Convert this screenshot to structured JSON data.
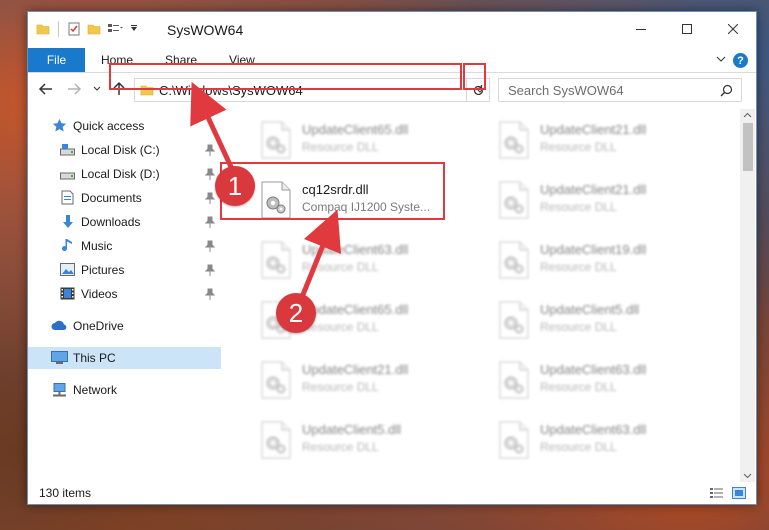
{
  "window": {
    "title": "SysWOW64"
  },
  "ribbon": {
    "tabs": [
      {
        "label": "File"
      },
      {
        "label": "Home"
      },
      {
        "label": "Share"
      },
      {
        "label": "View"
      }
    ]
  },
  "navigation": {
    "address": "C:\\Windows\\SysWOW64",
    "search_placeholder": "Search SysWOW64"
  },
  "sidebar": {
    "items": [
      {
        "label": "Quick access",
        "icon": "star-icon",
        "pinned": false
      },
      {
        "label": "Local Disk (C:)",
        "icon": "drive-icon",
        "pinned": true
      },
      {
        "label": "Local Disk (D:)",
        "icon": "drive-icon",
        "pinned": true
      },
      {
        "label": "Documents",
        "icon": "documents-icon",
        "pinned": true
      },
      {
        "label": "Downloads",
        "icon": "download-icon",
        "pinned": true
      },
      {
        "label": "Music",
        "icon": "music-icon",
        "pinned": true
      },
      {
        "label": "Pictures",
        "icon": "pictures-icon",
        "pinned": true
      },
      {
        "label": "Videos",
        "icon": "videos-icon",
        "pinned": true
      },
      {
        "label": "OneDrive",
        "icon": "cloud-icon",
        "pinned": false
      },
      {
        "label": "This PC",
        "icon": "computer-icon",
        "pinned": false,
        "selected": true
      },
      {
        "label": "Network",
        "icon": "network-icon",
        "pinned": false
      }
    ]
  },
  "files": [
    {
      "name": "UpdateClient65.dll",
      "desc": "Resource DLL"
    },
    {
      "name": "UpdateClient21.dll",
      "desc": "Resource DLL"
    },
    {
      "name": "cq12srdr.dll",
      "desc": "Compaq IJ1200 Syste...",
      "highlighted": true
    },
    {
      "name": "UpdateClient21.dll",
      "desc": "Resource DLL"
    },
    {
      "name": "UpdateClient63.dll",
      "desc": "Resource DLL"
    },
    {
      "name": "UpdateClient19.dll",
      "desc": "Resource DLL"
    },
    {
      "name": "UpdateClient65.dll",
      "desc": "Resource DLL"
    },
    {
      "name": "UpdateClient5.dll",
      "desc": "Resource DLL"
    },
    {
      "name": "UpdateClient21.dll",
      "desc": "Resource DLL"
    },
    {
      "name": "UpdateClient63.dll",
      "desc": "Resource DLL"
    },
    {
      "name": "UpdateClient5.dll",
      "desc": "Resource DLL"
    },
    {
      "name": "UpdateClient63.dll",
      "desc": "Resource DLL"
    }
  ],
  "status": {
    "item_count": "130 items"
  },
  "annotations": [
    {
      "label": "1"
    },
    {
      "label": "2"
    }
  ],
  "colors": {
    "accent": "#1979ca",
    "highlight_red": "#e0393e",
    "selected_bg": "#cce4f7"
  }
}
